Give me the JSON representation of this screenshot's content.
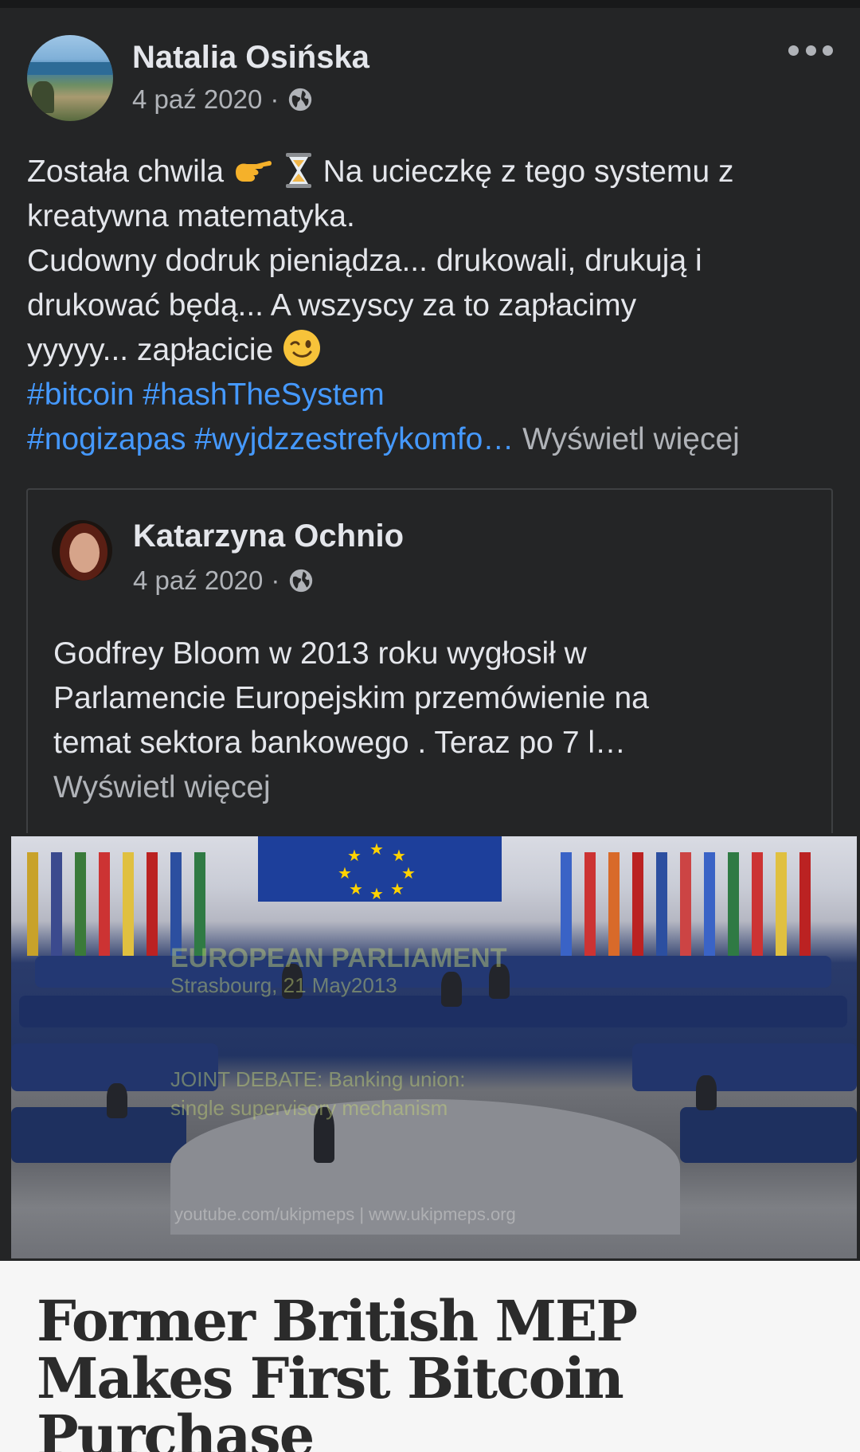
{
  "post": {
    "author": "Natalia Osińska",
    "date": "4 paź 2020",
    "separator": "·",
    "privacy_icon": "globe-icon",
    "more_icon": "more-options-icon",
    "text_lines": {
      "l1_before": "Została chwila",
      "l1_after": "Na ucieczkę z tego systemu z",
      "l2": "kreatywna matematyka.",
      "l3": "Cudowny dodruk pieniądza... drukowali, drukują i",
      "l4": "drukować będą... A wszyscy za to zapłacimy",
      "l5": "yyyyy... zapłacicie"
    },
    "hashtags": {
      "bitcoin": "#bitcoin",
      "hashthesystem": "#hashTheSystem",
      "nogizapas": "#nogizapas",
      "wyjdz": "#wyjdzzestrefykomfo…"
    },
    "see_more": "Wyświetl więcej"
  },
  "shared": {
    "author": "Katarzyna Ochnio",
    "date": "4 paź 2020",
    "separator": "·",
    "privacy_icon": "globe-icon",
    "text_lines": {
      "l1": "Godfrey Bloom w 2013 roku wygłosił w",
      "l2": "Parlamencie Europejskim przemówienie na",
      "l3": "temat sektora bankowego . Teraz po 7 l…"
    },
    "see_more": "Wyświetl więcej"
  },
  "video": {
    "overlay_title": "EUROPEAN PARLIAMENT",
    "overlay_location": "Strasbourg, 21 May2013",
    "overlay_debate_1": "JOINT DEBATE: Banking union:",
    "overlay_debate_2": "single supervisory mechanism",
    "overlay_url": "youtube.com/ukipmeps | www.ukipmeps.org"
  },
  "article": {
    "headline_1": "Former British MEP",
    "headline_2": "Makes First Bitcoin",
    "headline_3": "Purchase"
  },
  "colors": {
    "background": "#242526",
    "text": "#e4e6eb",
    "secondary": "#b0b3b8",
    "hashtag": "#4599ff"
  }
}
